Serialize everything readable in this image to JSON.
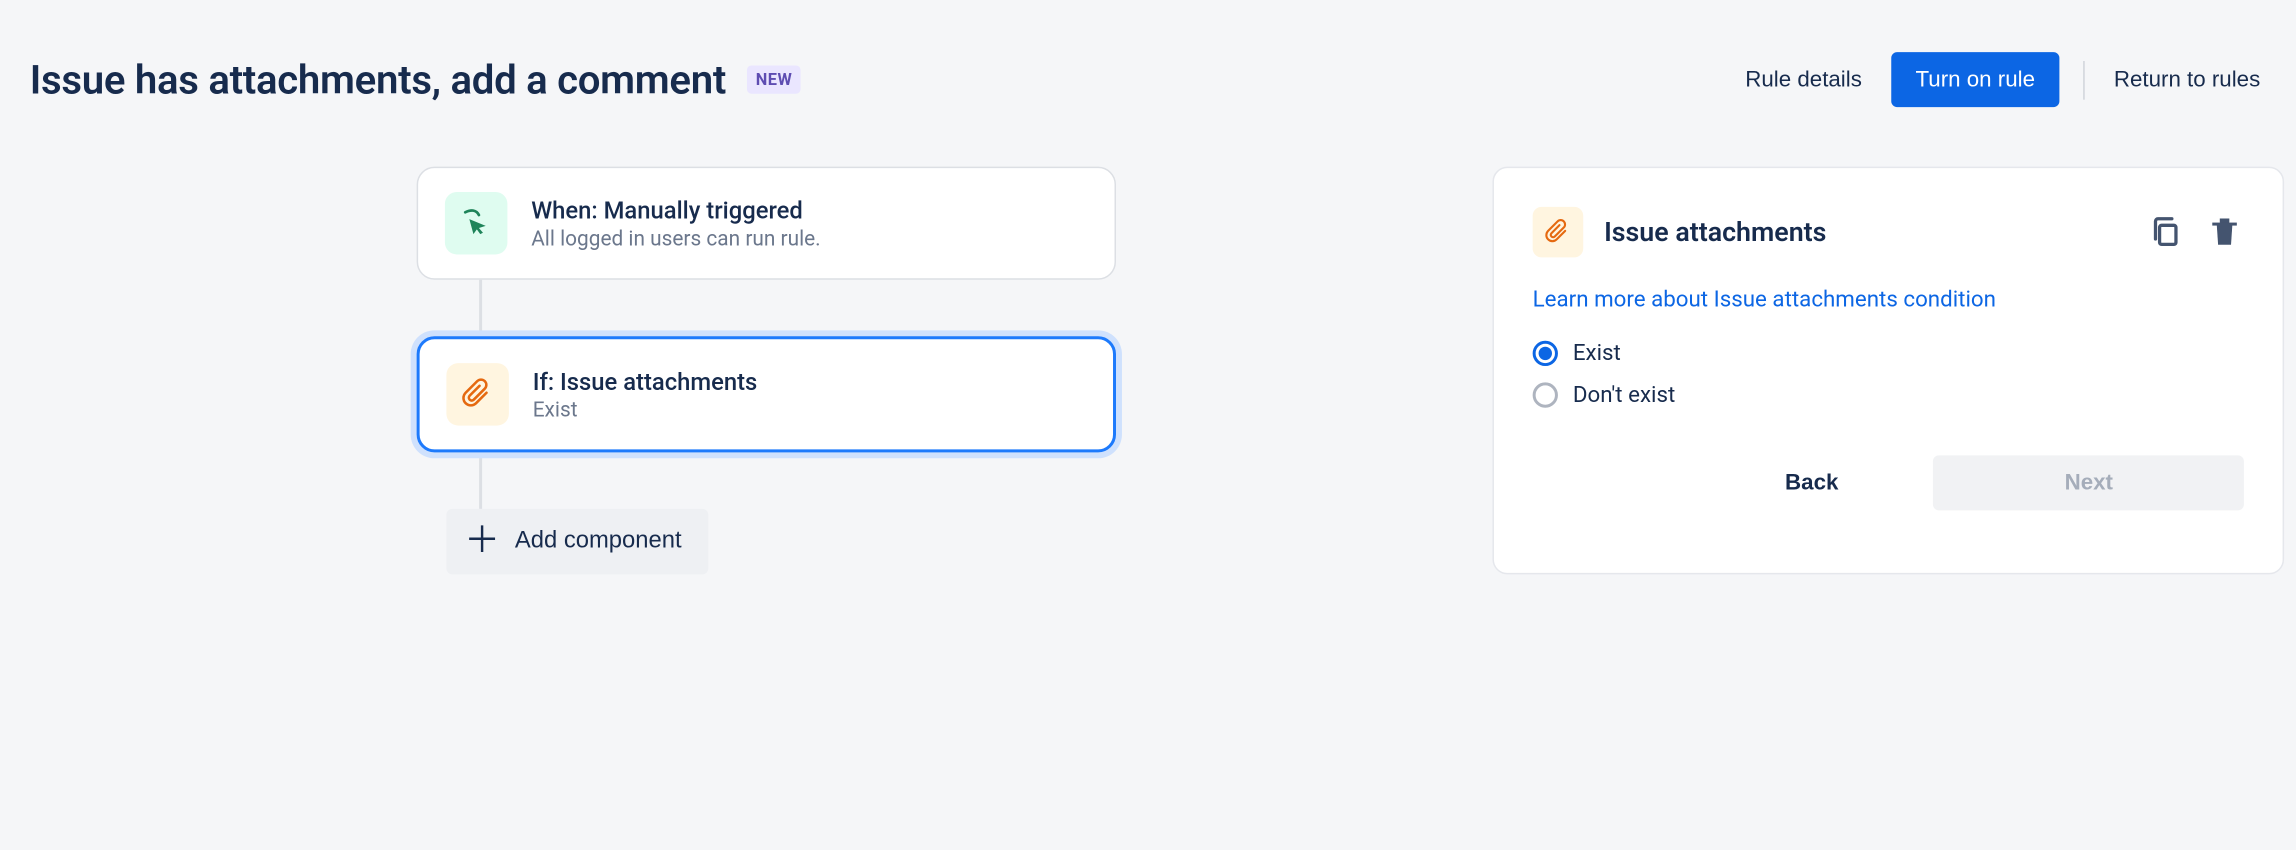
{
  "header": {
    "title": "Issue has attachments, add a comment",
    "badge": "NEW",
    "rule_details": "Rule details",
    "turn_on": "Turn on rule",
    "return": "Return to rules"
  },
  "flow": {
    "trigger": {
      "title": "When: Manually triggered",
      "subtitle": "All logged in users can run rule."
    },
    "condition": {
      "title": "If: Issue attachments",
      "subtitle": "Exist"
    },
    "add_component": "Add component"
  },
  "panel": {
    "title": "Issue attachments",
    "learn_more": "Learn more about Issue attachments condition",
    "options": {
      "exist": "Exist",
      "dont_exist": "Don't exist"
    },
    "back": "Back",
    "next": "Next"
  }
}
